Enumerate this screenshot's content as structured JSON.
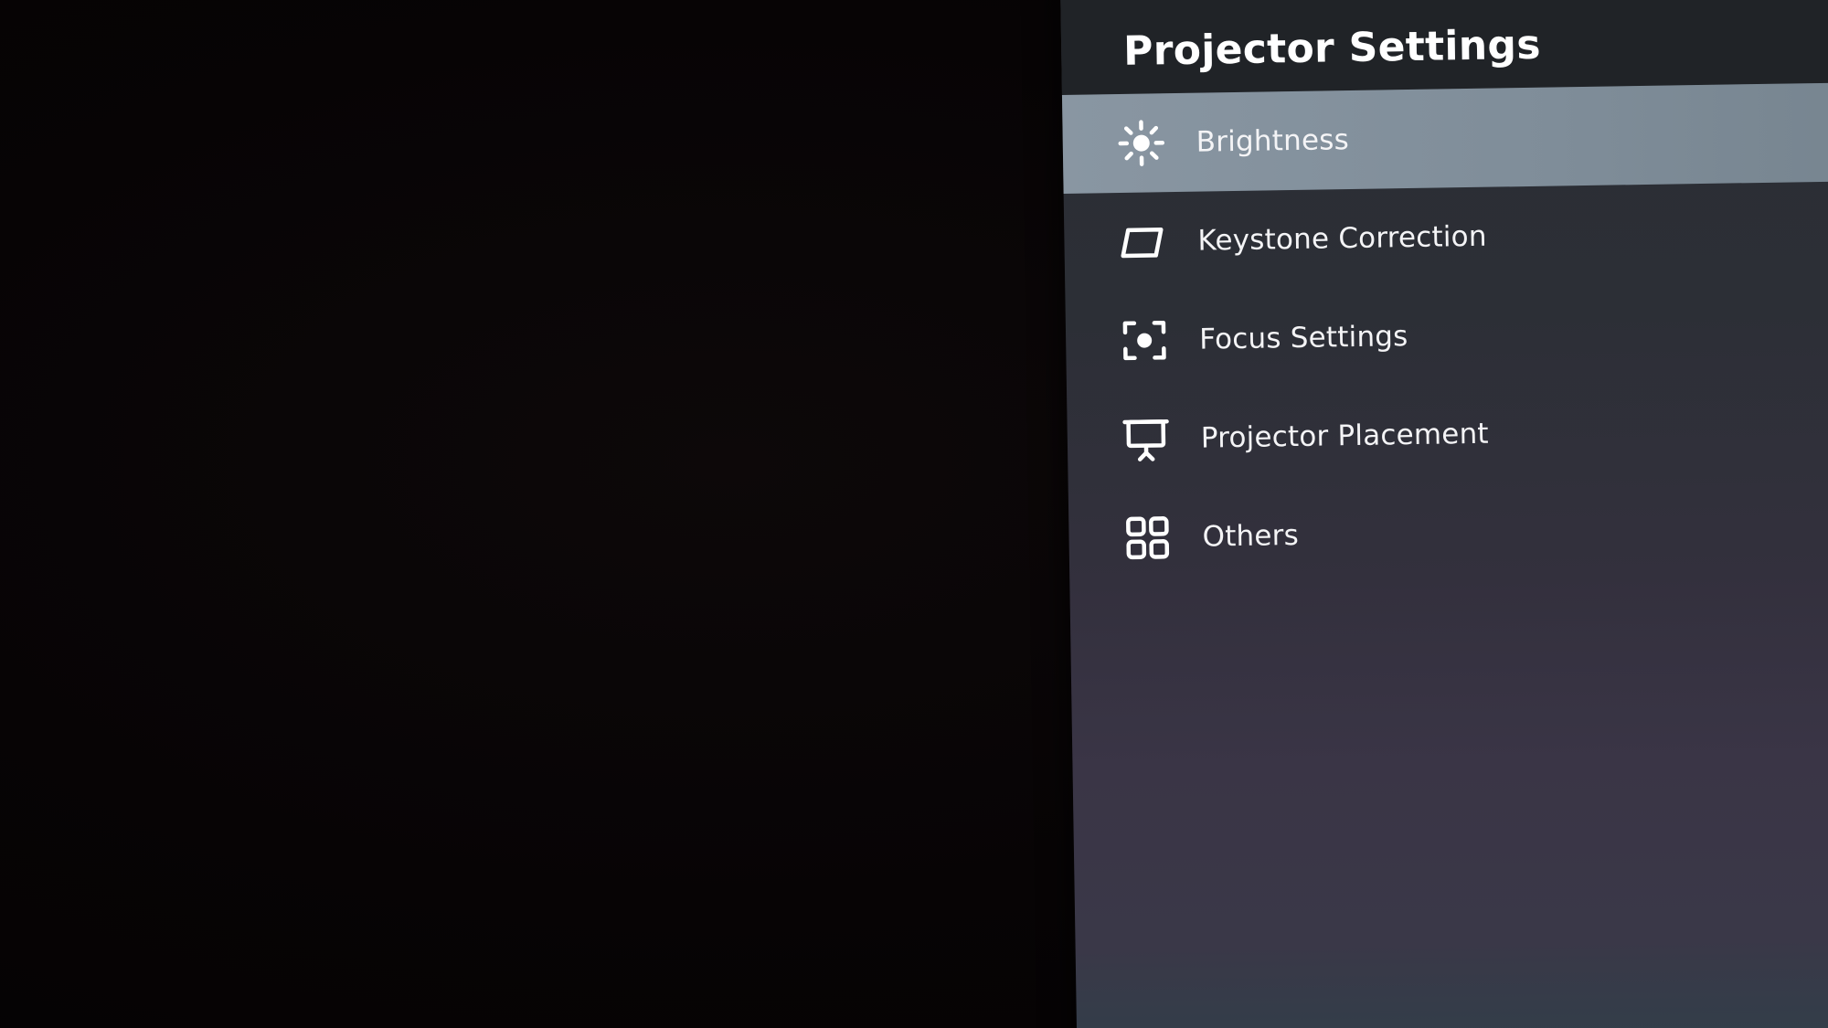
{
  "panel": {
    "title": "Projector Settings"
  },
  "menu": {
    "items": [
      {
        "label": "Brightness",
        "icon": "brightness-icon",
        "selected": true
      },
      {
        "label": "Keystone Correction",
        "icon": "keystone-icon",
        "selected": false
      },
      {
        "label": "Focus Settings",
        "icon": "focus-icon",
        "selected": false
      },
      {
        "label": "Projector Placement",
        "icon": "projector-screen-icon",
        "selected": false
      },
      {
        "label": "Others",
        "icon": "grid-icon",
        "selected": false
      }
    ]
  },
  "colors": {
    "selected_highlight": "#8996a2",
    "header_background": "#202327",
    "text": "#f4f4f6"
  }
}
